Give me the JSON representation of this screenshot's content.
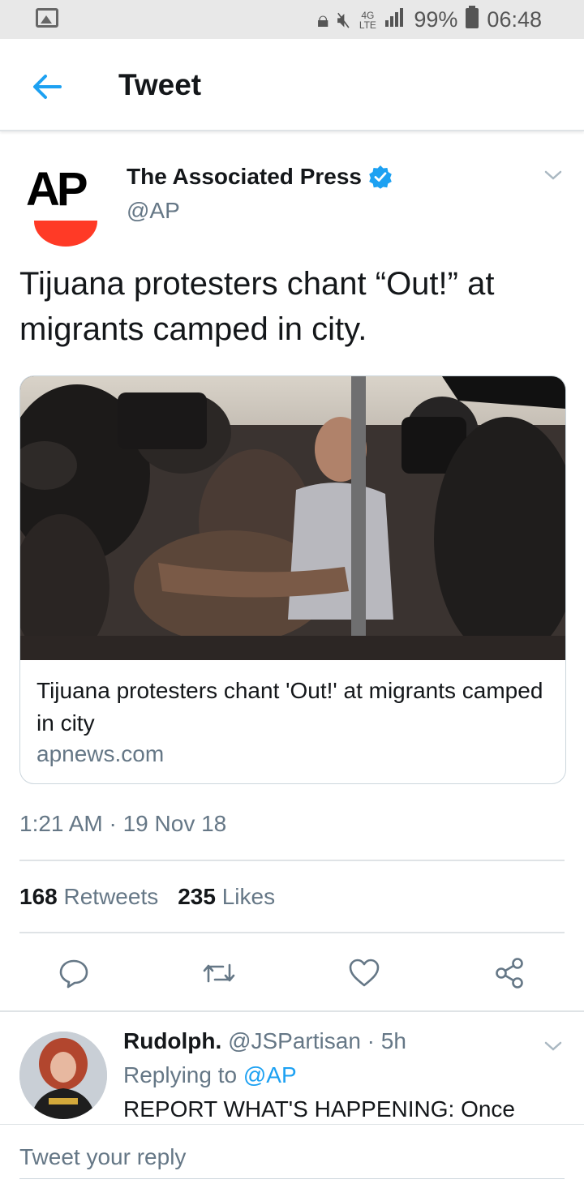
{
  "status_bar": {
    "network": "4G LTE",
    "battery": "99%",
    "time": "06:48"
  },
  "header": {
    "title": "Tweet"
  },
  "tweet": {
    "author_name": "The Associated Press",
    "author_handle": "@AP",
    "logo_text": "AP",
    "text": "Tijuana protesters chant “Out!” at migrants camped in city.",
    "card": {
      "title": "Tijuana protesters chant 'Out!' at migrants camped in city",
      "domain": "apnews.com"
    },
    "timestamp": "1:21 AM · 19 Nov 18",
    "retweets_count": "168",
    "retweets_label": "Retweets",
    "likes_count": "235",
    "likes_label": "Likes"
  },
  "reply": {
    "name": "Rudolph.",
    "handle_time": "@JSPartisan · 5h",
    "replying_to_label": "Replying to",
    "replying_to_mention": "@AP",
    "text": "REPORT WHAT'S HAPPENING: Once"
  },
  "compose": {
    "placeholder": "Tweet your reply"
  },
  "colors": {
    "accent": "#1da1f2",
    "muted": "#657786",
    "ap_red": "#ff3a26"
  }
}
